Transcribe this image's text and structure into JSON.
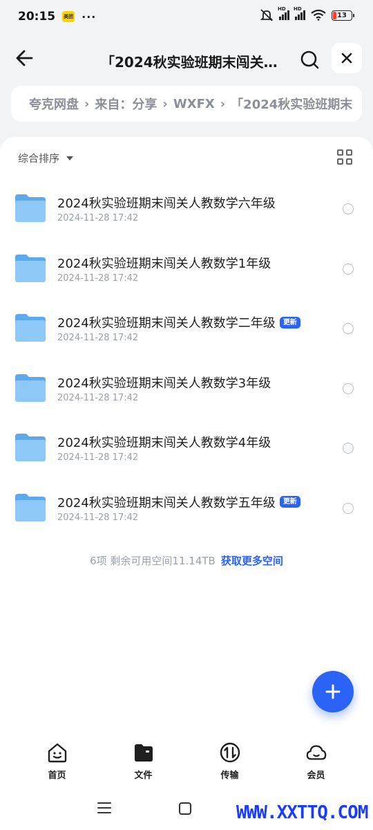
{
  "status_bar": {
    "time": "20:15",
    "app_badge": "美团",
    "more": "···",
    "hd1": "HD",
    "hd2": "HD",
    "battery": "13"
  },
  "title_bar": {
    "title": "「2024秋实验班期末闯关…"
  },
  "breadcrumb": {
    "items": [
      "夸克网盘",
      "来自：分享",
      "WXFX",
      "「2024秋实验班期末"
    ]
  },
  "sort": {
    "label": "综合排序"
  },
  "files": [
    {
      "name": "2024秋实验班期末闯关人教数学六年级",
      "date": "2024-11-28 17:42",
      "badge": ""
    },
    {
      "name": "2024秋实验班期末闯关人教数学1年级",
      "date": "2024-11-28 17:42",
      "badge": ""
    },
    {
      "name": "2024秋实验班期末闯关人教数学二年级",
      "date": "2024-11-28 17:42",
      "badge": "更新"
    },
    {
      "name": "2024秋实验班期末闯关人教数学3年级",
      "date": "2024-11-28 17:42",
      "badge": ""
    },
    {
      "name": "2024秋实验班期末闯关人教数学4年级",
      "date": "2024-11-28 17:42",
      "badge": ""
    },
    {
      "name": "2024秋实验班期末闯关人教数学五年级",
      "date": "2024-11-28 17:42",
      "badge": "更新"
    }
  ],
  "footer": {
    "count": "6项 剩余可用空间11.14TB",
    "link": "获取更多空间"
  },
  "bottom_nav": {
    "items": [
      {
        "label": "首页",
        "icon": "home-face-icon"
      },
      {
        "label": "文件",
        "icon": "folder-filled-icon"
      },
      {
        "label": "传输",
        "icon": "transfer-icon"
      },
      {
        "label": "会员",
        "icon": "cloud-icon"
      }
    ]
  },
  "watermark": "WWW.XXTTQ.COM",
  "colors": {
    "accent": "#2a63f5",
    "folder": "#6fb4f0",
    "background": "#f2f3f5"
  }
}
